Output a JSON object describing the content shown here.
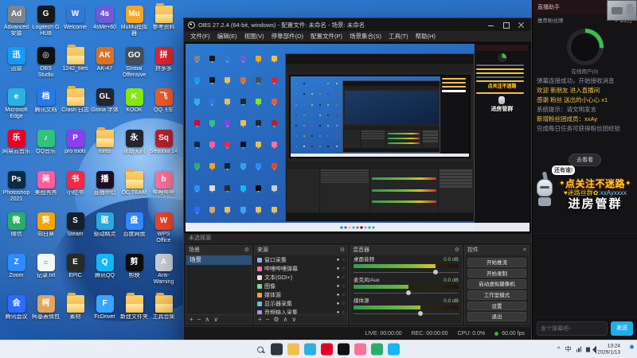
{
  "icons": {
    "gear": "⚙",
    "plus": "+",
    "minus": "−",
    "up": "∧",
    "down": "∨",
    "eye": "●",
    "lock": "○",
    "chevron": "^",
    "menu": "≡"
  },
  "desktop": {
    "icons": [
      {
        "label": "Advanced 安装",
        "glyph": "Ad",
        "color": "#7d848d"
      },
      {
        "label": "Logitech G HUB",
        "glyph": "G",
        "color": "#17181c"
      },
      {
        "label": "Welcome",
        "glyph": "W",
        "color": "#3178d8"
      },
      {
        "label": "4sMe+60",
        "glyph": "4s",
        "color": "#6f5bd8"
      },
      {
        "label": "MuMu模拟器",
        "glyph": "Mu",
        "color": "#f5a623"
      },
      {
        "label": "参考资料",
        "kind": "folder"
      },
      {
        "label": "迅雷",
        "glyph": "迅",
        "color": "#1799fa"
      },
      {
        "label": "OBS Studio",
        "glyph": "◎",
        "color": "#101010"
      },
      {
        "label": "1242_files",
        "kind": "folder"
      },
      {
        "label": "AK-47",
        "glyph": "AK",
        "color": "#e07020"
      },
      {
        "label": "Global Offensive",
        "glyph": "GO",
        "color": "#474d55"
      },
      {
        "label": "拼多多",
        "glyph": "拼",
        "color": "#e0242e"
      },
      {
        "label": "Microsoft Edge",
        "glyph": "e",
        "color": "#2bb3e0"
      },
      {
        "label": "腾讯文档",
        "glyph": "档",
        "color": "#2878f0"
      },
      {
        "label": "Crash 日志",
        "kind": "folder"
      },
      {
        "label": "Gloria 字体",
        "glyph": "GL",
        "color": "#23262b"
      },
      {
        "label": "KOOK",
        "glyph": "K",
        "color": "#86e80a"
      },
      {
        "label": "QQ飞车",
        "glyph": "飞",
        "color": "#f05a28"
      },
      {
        "label": "网易云音乐",
        "glyph": "乐",
        "color": "#e60026"
      },
      {
        "label": "QQ音乐",
        "glyph": "♪",
        "color": "#31c27c"
      },
      {
        "label": "pro tools",
        "glyph": "P",
        "color": "#8b3ff0"
      },
      {
        "label": "fonts",
        "kind": "folder"
      },
      {
        "label": "永劫无间",
        "glyph": "永",
        "color": "#23262e"
      },
      {
        "label": "Sequoia 14",
        "glyph": "Sq",
        "color": "#b3222e"
      },
      {
        "label": "Photoshop 2021",
        "glyph": "Ps",
        "color": "#0b2a44"
      },
      {
        "label": "美图秀秀",
        "glyph": "美",
        "color": "#ff5c9e"
      },
      {
        "label": "小红书",
        "glyph": "书",
        "color": "#ff2442"
      },
      {
        "label": "直播伴侣",
        "glyph": "播",
        "color": "#1b1022"
      },
      {
        "label": "OC TEAM",
        "kind": "folder"
      },
      {
        "label": "哔哩哔哩",
        "glyph": "b",
        "color": "#fb7299"
      },
      {
        "label": "微信",
        "glyph": "微",
        "color": "#2aae67"
      },
      {
        "label": "向日葵",
        "glyph": "葵",
        "color": "#f7a400"
      },
      {
        "label": "Steam",
        "glyph": "S",
        "color": "#16202d"
      },
      {
        "label": "驱动精灵",
        "glyph": "驱",
        "color": "#28a8e0"
      },
      {
        "label": "百度网盘",
        "glyph": "盘",
        "color": "#2f88ff"
      },
      {
        "label": "WPS Office",
        "glyph": "W",
        "color": "#eb442c"
      },
      {
        "label": "Zoom",
        "glyph": "Z",
        "color": "#2d8cff"
      },
      {
        "label": "记录.txt",
        "glyph": "≡",
        "kind": "doc"
      },
      {
        "label": "EPIC",
        "glyph": "E",
        "color": "#2a2a2a"
      },
      {
        "label": "腾讯QQ",
        "glyph": "Q",
        "color": "#12b7f5"
      },
      {
        "label": "剪映",
        "glyph": "剪",
        "color": "#0d0d0d"
      },
      {
        "label": "Anti-Warning",
        "glyph": "A",
        "color": "#c9ced6"
      },
      {
        "label": "腾讯会议",
        "glyph": "会",
        "color": "#2d6bff"
      },
      {
        "label": "柯基表情包",
        "glyph": "柯",
        "color": "#e0a45c"
      },
      {
        "label": "素材",
        "kind": "folder"
      },
      {
        "label": "FcDriver",
        "glyph": "F",
        "color": "#3aa3ff"
      },
      {
        "label": "新建文件夹",
        "kind": "folder"
      },
      {
        "label": "工具合集",
        "kind": "folder"
      }
    ]
  },
  "obs": {
    "window_title": "OBS 27.2.4 (64-bit, windows) - 配置文件: 未命名 - 场景: 未命名",
    "menu": [
      "文件(F)",
      "编辑(E)",
      "视图(V)",
      "停靠部件(D)",
      "配置文件(P)",
      "场景集合(S)",
      "工具(T)",
      "帮助(H)"
    ],
    "hint": "未选择源",
    "scenes": {
      "title": "场景",
      "items": [
        "场景"
      ]
    },
    "sources": {
      "title": "来源",
      "items": [
        {
          "name": "窗口采集",
          "color": "#8ab4f8"
        },
        {
          "name": "哔哩哔哩弹幕",
          "color": "#fb7299"
        },
        {
          "name": "文本(GDI+)",
          "color": "#e0e0e0"
        },
        {
          "name": "图像",
          "color": "#7bd88f"
        },
        {
          "name": "媒体源",
          "color": "#f2a33c"
        },
        {
          "name": "显示器采集",
          "color": "#5bc8d8"
        },
        {
          "name": "音频输入采集",
          "color": "#b48ef0"
        }
      ]
    },
    "mixer": {
      "title": "混音器",
      "channels": [
        {
          "name": "桌面音频",
          "db": "0.0 dB",
          "level": 78
        },
        {
          "name": "麦克风/Aux",
          "db": "0.0 dB",
          "level": 52
        },
        {
          "name": "媒体源",
          "db": "0.0 dB",
          "level": 64
        }
      ]
    },
    "controls": {
      "title": "控件",
      "buttons": [
        "开始推流",
        "开始录制",
        "启动虚拟摄像机",
        "工作室模式",
        "设置",
        "退出"
      ]
    },
    "status": {
      "live": "LIVE: 00:00:00",
      "rec": "REC: 00:00:00",
      "cpu": "CPU: 0.0%",
      "fps": "60.00 fps"
    }
  },
  "panel": {
    "title": "直播助手",
    "fan_badge_label": "推荐粉丝牌",
    "popularity": "2/2万",
    "online_label": "在线用户(0)",
    "messages": [
      {
        "tone": "gray",
        "text": "弹幕连接成功，开始接收消息"
      },
      {
        "tone": "gift",
        "text": "欢迎 新朋友 进入直播间"
      },
      {
        "tone": "gift",
        "text": "感谢 粉丝 送出的小心心 x1"
      },
      {
        "tone": "gray",
        "text": "系统提示：请文明发言"
      },
      {
        "tone": "gift",
        "text": "新增粉丝团成员：xxAy"
      },
      {
        "tone": "gray",
        "text": "完成每日任务可获得粉丝团经验"
      }
    ],
    "see_button": "去看看",
    "banner": {
      "star": "✦",
      "title": "点关注不迷路",
      "group_prefix": "♥迷路丝群✿:",
      "group_name": "xxAyxxxx",
      "room": "进房管群",
      "bubble": "还有谁!"
    },
    "input_placeholder": "发个弹幕吧~",
    "send_label": "发送"
  },
  "taskbar": {
    "icons": [
      {
        "name": "start",
        "color": "#0f7bd7"
      },
      {
        "name": "search",
        "color": "#5a6068"
      },
      {
        "name": "task-view",
        "color": "#30343c"
      },
      {
        "name": "explorer",
        "color": "#f1c04a"
      },
      {
        "name": "edge",
        "color": "#2fb1e0"
      },
      {
        "name": "netease-music",
        "color": "#e60026"
      },
      {
        "name": "obs",
        "color": "#101010"
      },
      {
        "name": "bilibili-live",
        "color": "#fb7299"
      },
      {
        "name": "wechat",
        "color": "#2aae67"
      },
      {
        "name": "qq",
        "color": "#12b7f5"
      }
    ],
    "tray": {
      "lang": "中",
      "time": "13:24",
      "date": "2026/1/13"
    }
  }
}
